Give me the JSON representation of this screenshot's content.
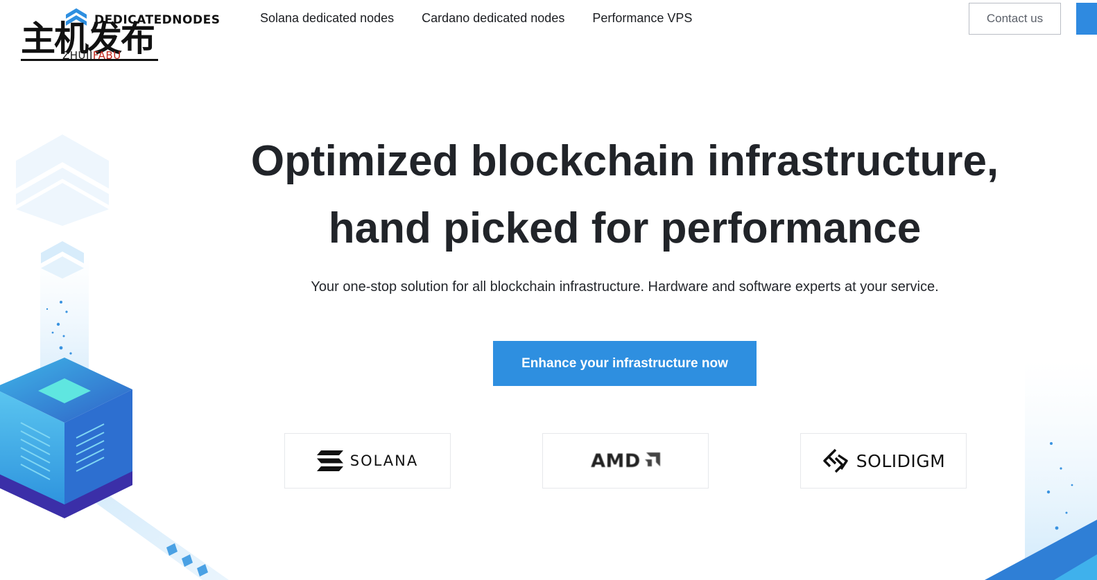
{
  "brand": {
    "name": "DEDICATEDNODES",
    "watermark_cn": "主机发布",
    "watermark_en_a": "ZHUJI",
    "watermark_en_b": "FABU"
  },
  "nav": {
    "items": [
      {
        "label": "Solana dedicated nodes"
      },
      {
        "label": "Cardano dedicated nodes"
      },
      {
        "label": "Performance VPS"
      }
    ],
    "contact_label": "Contact us"
  },
  "hero": {
    "title_line1": "Optimized blockchain infrastructure,",
    "title_line2": "hand picked for performance",
    "subtitle": "Your one-stop solution for all blockchain infrastructure. Hardware and software experts at your service.",
    "cta_label": "Enhance your infrastructure now"
  },
  "partners": [
    {
      "name": "SOLANA",
      "icon": "solana-logo-icon"
    },
    {
      "name": "AMD",
      "icon": "amd-arrow-icon"
    },
    {
      "name": "SOLIDIGM",
      "icon": "solidigm-logo-icon"
    }
  ],
  "colors": {
    "accent": "#2e8fe0",
    "text": "#212429",
    "border": "#e6e8eb",
    "watermark_red": "#c0271c"
  }
}
